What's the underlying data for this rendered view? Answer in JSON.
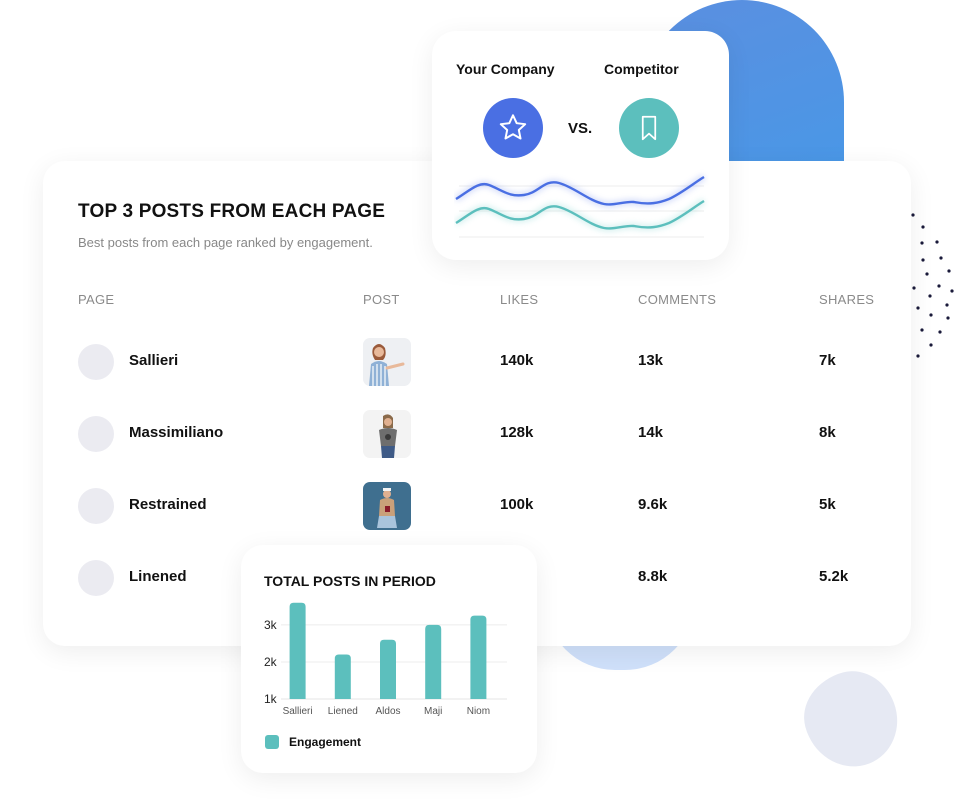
{
  "colors": {
    "accent_blue": "#4a6fe3",
    "accent_teal": "#5cbfbd",
    "text_primary": "#111111",
    "text_muted": "#888888"
  },
  "main_card": {
    "title": "TOP 3 POSTS FROM EACH PAGE",
    "subtitle": "Best posts from each page ranked by engagement.",
    "columns": [
      "PAGE",
      "POST",
      "LIKES",
      "COMMENTS",
      "SHARES"
    ],
    "rows": [
      {
        "page": "Sallieri",
        "post_image": "woman-striped-shirt-photo",
        "likes": "140k",
        "comments": "13k",
        "shares": "7k"
      },
      {
        "page": "Massimiliano",
        "post_image": "woman-grey-tshirt-photo",
        "likes": "128k",
        "comments": "14k",
        "shares": "8k"
      },
      {
        "page": "Restrained",
        "post_image": "woman-blue-background-photo",
        "likes": "100k",
        "comments": "9.6k",
        "shares": "5k"
      },
      {
        "page": "Linened",
        "post_image": "",
        "likes": "",
        "comments": "8.8k",
        "shares": "5.2k"
      }
    ]
  },
  "comparison_card": {
    "left_label": "Your Company",
    "right_label": "Competitor",
    "vs_text": "VS.",
    "left_icon": "star-icon",
    "right_icon": "bookmark-icon"
  },
  "chart_data": {
    "type": "bar",
    "title": "TOTAL POSTS IN PERIOD",
    "categories": [
      "Sallieri",
      "Liened",
      "Aldos",
      "Maji",
      "Niom"
    ],
    "series": [
      {
        "name": "Engagement",
        "values": [
          3600,
          2200,
          2600,
          3000,
          3250
        ]
      }
    ],
    "yticks": [
      "1k",
      "2k",
      "3k"
    ],
    "ytick_values": [
      1000,
      2000,
      3000
    ],
    "ylim": [
      1000,
      3700
    ],
    "xlabel": "",
    "ylabel": "",
    "grid": true,
    "legend": "bottom-left"
  }
}
